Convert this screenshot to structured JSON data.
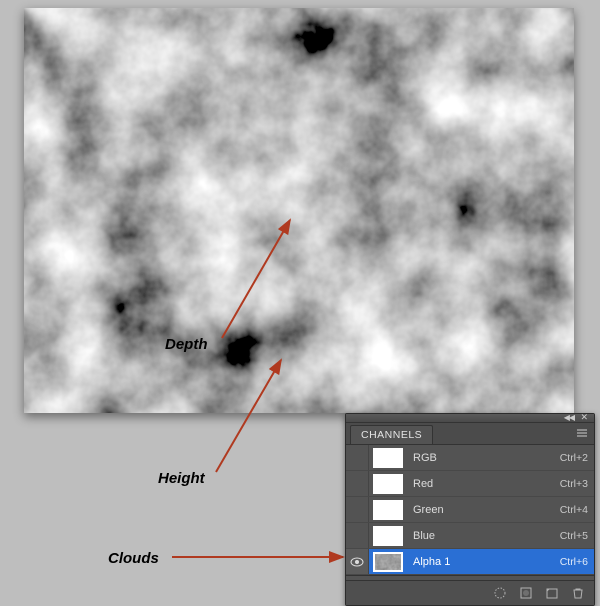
{
  "annotations": {
    "depth_label": "Depth",
    "height_label": "Height",
    "clouds_label": "Clouds"
  },
  "panel": {
    "tab_title": "CHANNELS",
    "channels": [
      {
        "name": "RGB",
        "shortcut": "Ctrl+2",
        "eye_visible": false,
        "selected": false,
        "thumb": "white"
      },
      {
        "name": "Red",
        "shortcut": "Ctrl+3",
        "eye_visible": false,
        "selected": false,
        "thumb": "white"
      },
      {
        "name": "Green",
        "shortcut": "Ctrl+4",
        "eye_visible": false,
        "selected": false,
        "thumb": "white"
      },
      {
        "name": "Blue",
        "shortcut": "Ctrl+5",
        "eye_visible": false,
        "selected": false,
        "thumb": "white"
      },
      {
        "name": "Alpha 1",
        "shortcut": "Ctrl+6",
        "eye_visible": true,
        "selected": true,
        "thumb": "alpha"
      }
    ],
    "footer_icons": {
      "load_selection": "load-selection-icon",
      "save_selection": "save-selection-icon",
      "new_channel": "new-channel-icon",
      "delete_channel": "delete-icon"
    }
  }
}
